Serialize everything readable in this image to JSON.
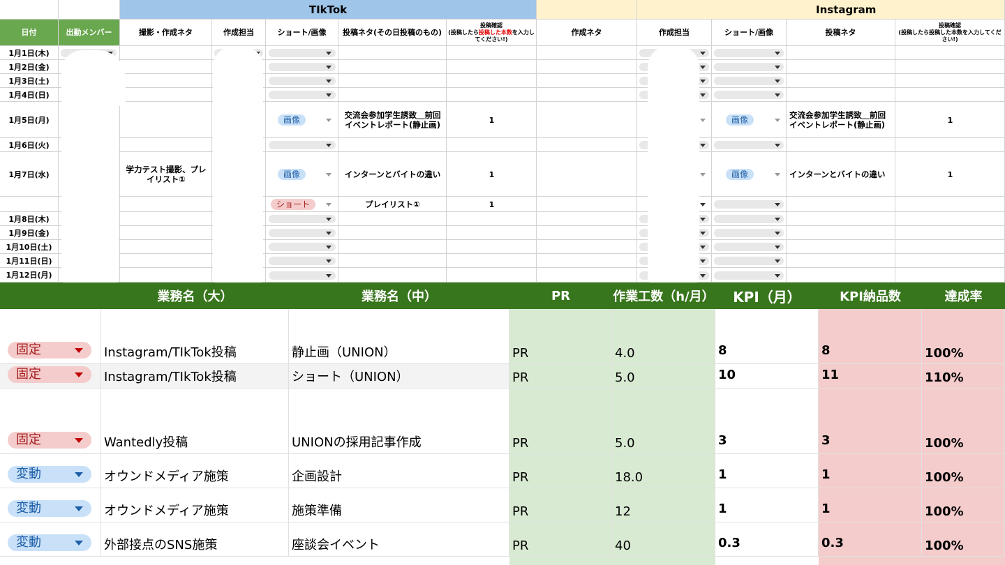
{
  "tiktok": {
    "title": "TIkTok",
    "columns": [
      "撮影・作成ネタ",
      "作成担当",
      "ショート/画像",
      "投稿ネタ(その日投稿のもの)",
      "投稿確認"
    ],
    "note_black1": "(投稿したら",
    "note_red": "投稿した本数",
    "note_black2": "を入力してください!)"
  },
  "instagram": {
    "title": "Instagram",
    "columns": [
      "作成ネタ",
      "作成担当",
      "ショート/画像",
      "投稿ネタ",
      "投稿確認"
    ],
    "note": "(投稿したら投稿した本数を入力してください!)"
  },
  "left_headers": {
    "date": "日付",
    "member": "出勤メンバー"
  },
  "dates": [
    "1月1日(木)",
    "1月2日(金)",
    "1月3日(土)",
    "1月4日(日)",
    "1月5日(月)",
    "1月6日(火)",
    "1月7日(水)",
    "",
    "1月8日(木)",
    "1月9日(金)",
    "1月10日(土)",
    "1月11日(日)",
    "1月12日(月)"
  ],
  "rows_content": {
    "r5": {
      "type": "画像",
      "tiktok_topic": "交流会参加学生誘致＿前回イベントレポート(静止画)",
      "tiktok_count": "1",
      "ig_type": "画像",
      "ig_topic": "交流会参加学生誘致＿前回イベントレポート(静止画)",
      "ig_count": "1"
    },
    "r7": {
      "shoot": "学力テスト撮影、プレイリスト①",
      "type": "画像",
      "tiktok_topic": "インターンとバイトの違い",
      "tiktok_count": "1",
      "ig_type": "画像",
      "ig_topic": "インターンとバイトの違い",
      "ig_count": "1"
    },
    "r7b": {
      "type": "ショート",
      "tiktok_topic": "プレイリスト①",
      "tiktok_count": "1"
    }
  },
  "bottom": {
    "headers": [
      "業務名（大）",
      "業務名（中）",
      "PR",
      "作業工数（h/月）",
      "KPI（月）",
      "KPI納品数",
      "達成率"
    ],
    "rows": [
      {
        "tag": "固定",
        "tag_color": "#f4cccc",
        "big": "Instagram/TIkTok投稿",
        "mid": "静止画（UNION）",
        "pr": "PR",
        "hours": "4.0",
        "kpi": "8",
        "delivered": "8",
        "rate": "100%"
      },
      {
        "tag": "固定",
        "tag_color": "#f4cccc",
        "big": "Instagram/TIkTok投稿",
        "mid": "ショート（UNION）",
        "pr": "PR",
        "hours": "5.0",
        "kpi": "10",
        "delivered": "11",
        "rate": "110%"
      },
      {
        "tag": "固定",
        "tag_color": "#f4cccc",
        "big": "Wantedly投稿",
        "mid": "UNIONの採用記事作成",
        "pr": "PR",
        "hours": "5.0",
        "kpi": "3",
        "delivered": "3",
        "rate": "100%"
      },
      {
        "tag": "変動",
        "tag_color": "#c9e1f8",
        "big": "オウンドメディア施策",
        "mid": "企画設計",
        "pr": "PR",
        "hours": "18.0",
        "kpi": "1",
        "delivered": "1",
        "rate": "100%"
      },
      {
        "tag": "変動",
        "tag_color": "#c9e1f8",
        "big": "オウンドメディア施策",
        "mid": "施策準備",
        "pr": "PR",
        "hours": "12",
        "kpi": "1",
        "delivered": "1",
        "rate": "100%"
      },
      {
        "tag": "変動",
        "tag_color": "#c9e1f8",
        "big": "外部接点のSNS施策",
        "mid": "座談会イベント",
        "pr": "PR",
        "hours": "40",
        "kpi": "0.3",
        "delivered": "0.3",
        "rate": "100%"
      }
    ]
  },
  "colors": {
    "green": "#38761d",
    "tiktok_blue": "#9fc5e8",
    "insta_yellow": "#fff2cc",
    "pr_green": "#d9ead3",
    "kpi_pink": "#f4cccc",
    "fixed_red": "#a61c1c",
    "var_blue": "#1f5fa8"
  }
}
